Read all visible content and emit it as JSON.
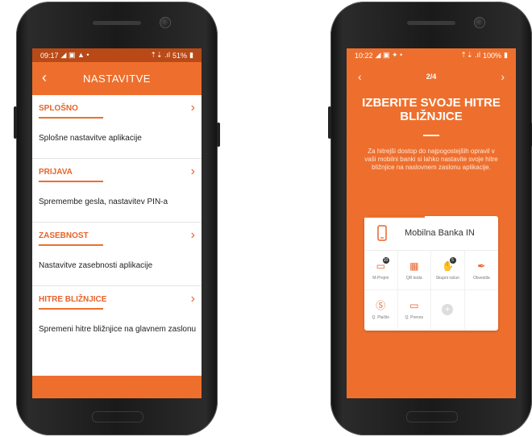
{
  "left_phone": {
    "status": {
      "time": "09:17",
      "left_icons": "◢ ▣ ▲ •",
      "right_icons": "⇡⇣ .ıl",
      "battery": "51%"
    },
    "header": {
      "back_icon": "chevron-left-icon",
      "title": "NASTAVITVE"
    },
    "sections": [
      {
        "heading": "SPLOŠNO",
        "text": "Splošne nastavitve aplikacije"
      },
      {
        "heading": "PRIJAVA",
        "text": "Spremembe gesla, nastavitev PIN-a"
      },
      {
        "heading": "ZASEBNOST",
        "text": "Nastavitve zasebnosti aplikacije"
      },
      {
        "heading": "HITRE BLIŽNJICE",
        "text": "Spremeni hitre bližnjice na glavnem zaslonu"
      }
    ]
  },
  "right_phone": {
    "status": {
      "time": "10:22",
      "left_icons": "◢ ▣ ✦ •",
      "right_icons": "⇡⇣ .ıl",
      "battery": "100%"
    },
    "pager": {
      "label": "2/4"
    },
    "title": "IZBERITE SVOJE HITRE BLIŽNJICE",
    "description": "Za hitrejši dostop do najpogostejših opravil v vaši mobilni banki si lahko nastavite svoje hitre bližnjice na naslovnem zaslonu aplikacije.",
    "card": {
      "brand": "Mobilna Banka IN",
      "tiles": [
        {
          "label": "M-Prejmi",
          "icon": "wallet-icon",
          "badge": "10"
        },
        {
          "label": "QR koda",
          "icon": "qr-code-icon",
          "badge": ""
        },
        {
          "label": "Skupni račun",
          "icon": "hands-icon",
          "badge": "5"
        },
        {
          "label": "Obvestila",
          "icon": "megaphone-icon",
          "badge": ""
        },
        {
          "label": "Q. Plačilo",
          "icon": "coin-icon",
          "badge": ""
        },
        {
          "label": "Q. Prenos",
          "icon": "wallet-icon",
          "badge": ""
        },
        {
          "label": "",
          "icon": "plus-icon",
          "badge": ""
        },
        {
          "label": "",
          "icon": "",
          "badge": ""
        }
      ]
    }
  },
  "colors": {
    "accent": "#ee6f2d",
    "accent_dark": "#b94a17"
  }
}
